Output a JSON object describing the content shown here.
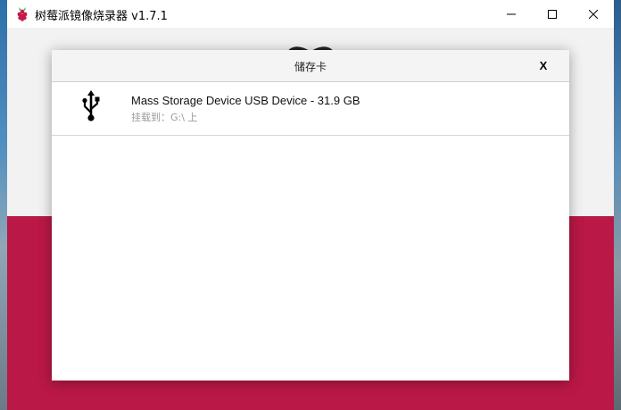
{
  "window": {
    "title": "树莓派镜像烧录器 v1.7.1",
    "controls": [
      "minimize",
      "maximize",
      "close"
    ]
  },
  "dialog": {
    "title": "储存卡",
    "close_label": "X",
    "devices": [
      {
        "name": "Mass Storage Device USB Device - 31.9 GB",
        "mount": "挂载到：G:\\ 上",
        "icon": "usb-icon"
      }
    ]
  },
  "colors": {
    "accent": "#c51a4a",
    "dialog_header": "#f4f4f4"
  }
}
